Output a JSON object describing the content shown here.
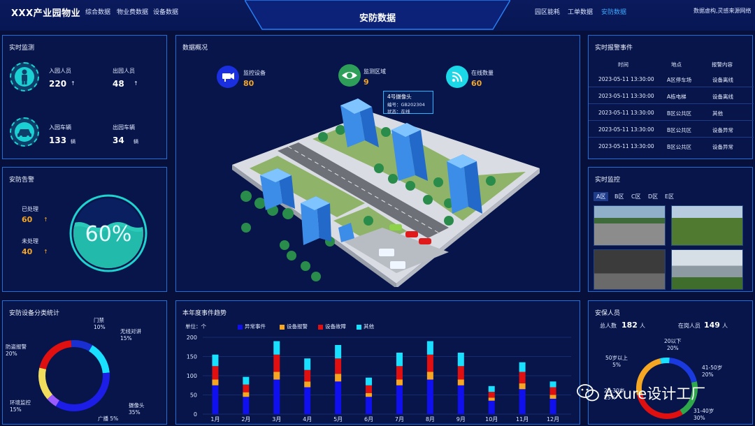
{
  "header": {
    "brand": "XXX产业园物业",
    "nav_left": [
      "综合数据",
      "物业费数据",
      "设备数据"
    ],
    "title": "安防数据",
    "nav_right": [
      "园区能耗",
      "工单数据",
      "安防数据"
    ],
    "active_nav": "安防数据",
    "source": "数据虚构,灵感来源网络"
  },
  "realtime": {
    "title": "实时监测",
    "in_people_label": "入园人员",
    "in_people": "220",
    "out_people_label": "出园人员",
    "out_people": "48",
    "in_cars_label": "入园车辆",
    "in_cars": "133",
    "out_cars_label": "出园车辆",
    "out_cars": "34",
    "car_unit": "辆",
    "arrow": "↑"
  },
  "alarm": {
    "title": "安防告警",
    "processed_label": "已处理",
    "processed": "60",
    "unprocessed_label": "未处理",
    "unprocessed": "40",
    "percent": "60%",
    "arrow": "↑"
  },
  "overview": {
    "title": "数据概况",
    "stats": [
      {
        "label": "监控设备",
        "value": "80",
        "icon": "camera-icon"
      },
      {
        "label": "监测区域",
        "value": "9",
        "icon": "eye-icon"
      },
      {
        "label": "在线数量",
        "value": "60",
        "icon": "wifi-icon"
      }
    ],
    "tooltip": {
      "name": "4号摄像头",
      "id_line": "编号：GB202304",
      "status_line": "状态：在线"
    }
  },
  "events": {
    "title": "实时报警事件",
    "columns": [
      "时间",
      "地点",
      "报警内容"
    ],
    "rows": [
      [
        "2023-05-11 13:30:00",
        "A区停车场",
        "设备离线"
      ],
      [
        "2023-05-11 13:30:00",
        "A栋电梯",
        "设备离线"
      ],
      [
        "2023-05-11 13:30:00",
        "B区公共区",
        "其他"
      ],
      [
        "2023-05-11 13:30:00",
        "B区公共区",
        "设备异常"
      ],
      [
        "2023-05-11 13:30:00",
        "B区公共区",
        "设备异常"
      ]
    ]
  },
  "monitor": {
    "title": "实时监控",
    "zones": [
      "A区",
      "B区",
      "C区",
      "D区",
      "E区"
    ],
    "selected_zone": "A区"
  },
  "device_pie": {
    "title": "安防设备分类统计",
    "slices": [
      {
        "name": "门禁",
        "pct": "10%",
        "value": 10,
        "color": "#1a2fd0"
      },
      {
        "name": "无线对讲",
        "pct": "15%",
        "value": 15,
        "color": "#19e0ff"
      },
      {
        "name": "摄像头",
        "pct": "35%",
        "value": 35,
        "color": "#1d1de8"
      },
      {
        "name": "广播",
        "pct": "5%",
        "value": 5,
        "color": "#9b5cff"
      },
      {
        "name": "环境监控",
        "pct": "15%",
        "value": 15,
        "color": "#f2de5c"
      },
      {
        "name": "防盗报警",
        "pct": "20%",
        "value": 20,
        "color": "#e01010"
      }
    ]
  },
  "trend": {
    "title": "本年度事件趋势",
    "unit": "单位：个"
  },
  "chart_data": {
    "type": "bar",
    "title": "本年度事件趋势",
    "ylabel": "单位：个",
    "ylim": [
      0,
      200
    ],
    "yticks": [
      0,
      50,
      100,
      150,
      200
    ],
    "categories": [
      "1月",
      "2月",
      "3月",
      "4月",
      "5月",
      "6月",
      "7月",
      "8月",
      "9月",
      "10月",
      "11月",
      "12月"
    ],
    "series": [
      {
        "name": "异常事件",
        "color": "#1010ee",
        "values": [
          75,
          45,
          90,
          70,
          85,
          45,
          75,
          90,
          75,
          35,
          65,
          40
        ]
      },
      {
        "name": "设备报警",
        "color": "#f5a623",
        "values": [
          15,
          12,
          20,
          15,
          20,
          10,
          15,
          20,
          15,
          8,
          15,
          10
        ]
      },
      {
        "name": "设备故障",
        "color": "#e01010",
        "values": [
          35,
          20,
          45,
          30,
          40,
          20,
          35,
          45,
          35,
          15,
          30,
          20
        ]
      },
      {
        "name": "其他",
        "color": "#19e0ff",
        "values": [
          30,
          20,
          35,
          30,
          35,
          20,
          35,
          35,
          35,
          15,
          25,
          15
        ]
      }
    ]
  },
  "staff": {
    "title": "安保人员",
    "total_label": "总人数",
    "total": "182",
    "onduty_label": "在岗人员",
    "onduty": "149",
    "unit": "人",
    "slices": [
      {
        "name": "20以下",
        "pct": "20%",
        "value": 20,
        "color": "#1a3ae0"
      },
      {
        "name": "41-50岁",
        "pct": "20%",
        "value": 20,
        "color": "#2ea84a"
      },
      {
        "name": "31-40岁",
        "pct": "30%",
        "value": 30,
        "color": "#e01010"
      },
      {
        "name": "20-30岁",
        "pct": "25%",
        "value": 25,
        "color": "#f5a623"
      },
      {
        "name": "50岁以上",
        "pct": "5%",
        "value": 5,
        "color": "#19e0ff"
      }
    ]
  },
  "watermark": "Axure设计工厂"
}
